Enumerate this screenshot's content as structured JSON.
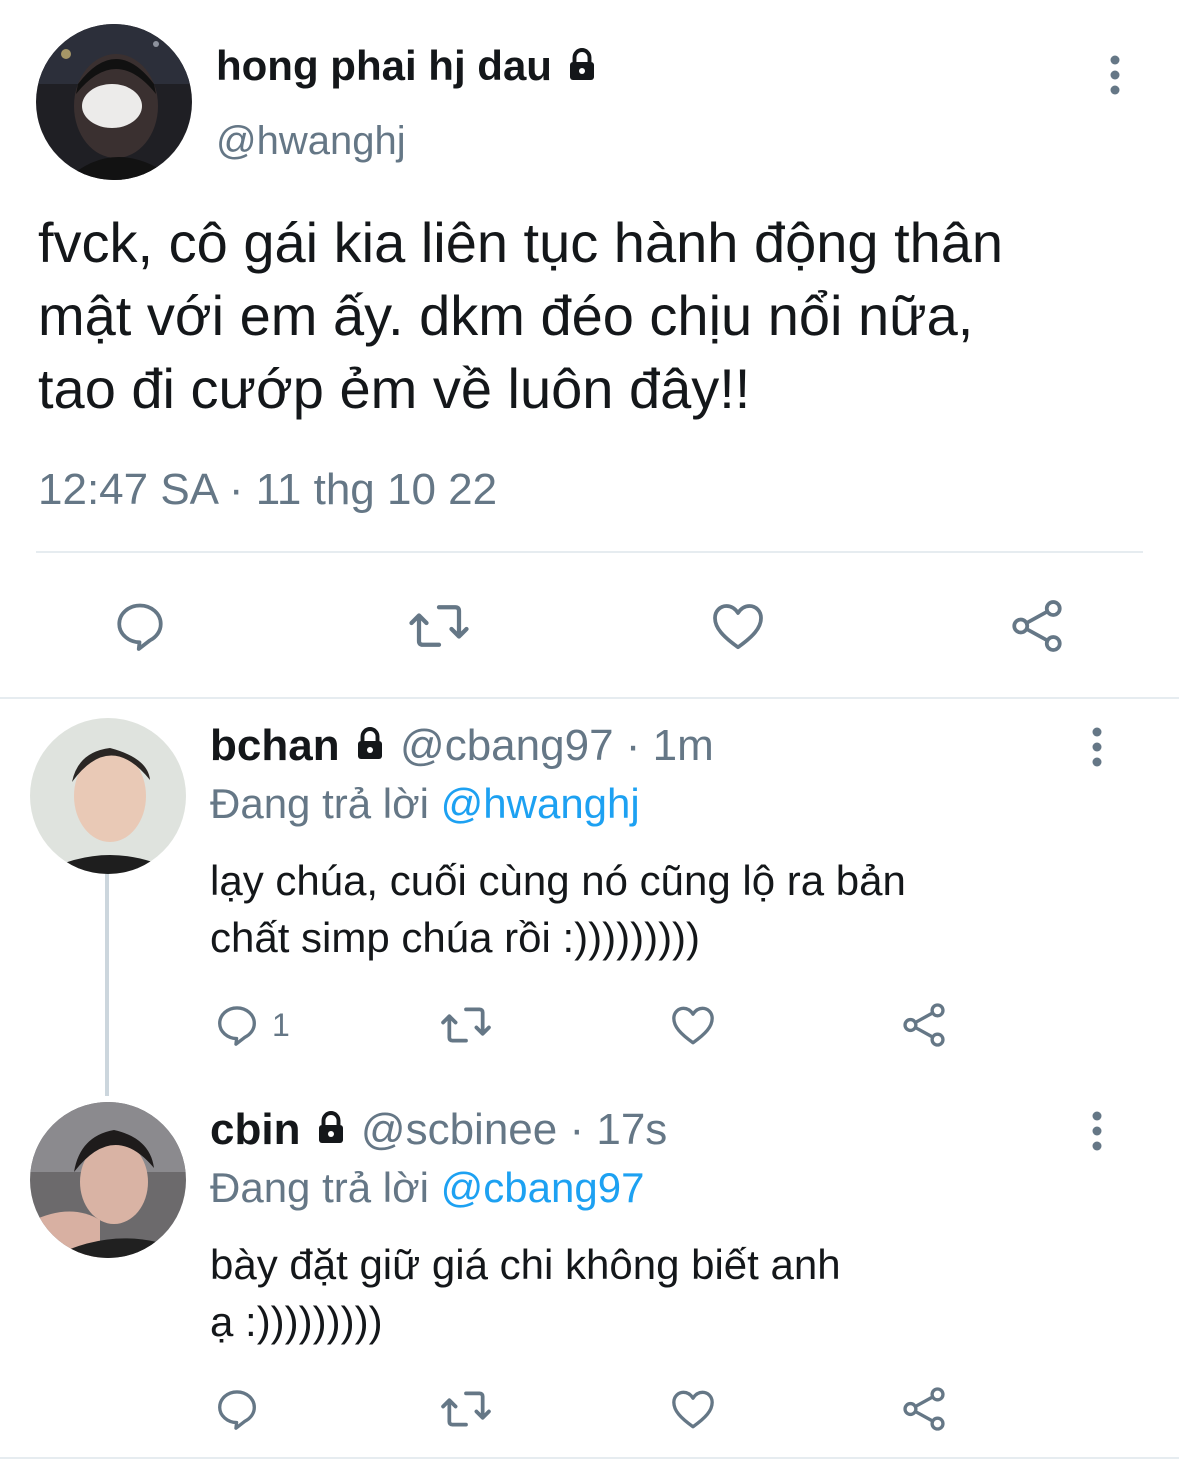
{
  "main_tweet": {
    "display_name": "hong phai hj dau",
    "handle": "@hwanghj",
    "text_lines": [
      "fvck, cô gái kia liên tục hành động thân",
      "mật với em ấy. dkm đéo chịu nổi nữa,",
      "tao đi cướp ẻm về luôn đây!!"
    ],
    "timestamp": "12:47 SA · 11 thg 10 22",
    "icons": {
      "avatar": "avatar-photo",
      "lock": "lock-icon",
      "more": "more-vertical-icon",
      "reply": "reply-icon",
      "retweet": "retweet-icon",
      "like": "heart-icon",
      "share": "share-icon"
    }
  },
  "replies": [
    {
      "display_name": "bchan",
      "handle_time": "@cbang97 · 1m",
      "replying_prefix": "Đang trả lời",
      "replying_to": "@hwanghj",
      "text_lines": [
        "lạy chúa, cuối cùng nó cũng lộ ra bản",
        "chất simp chúa rồi :)))))))))"
      ],
      "reply_count": "1"
    },
    {
      "display_name": "cbin",
      "handle_time": "@scbinee · 17s",
      "replying_prefix": "Đang trả lời",
      "replying_to": "@cbang97",
      "text_lines": [
        "bày đặt giữ giá chi không biết anh",
        "ạ :)))))))))"
      ],
      "reply_count": ""
    }
  ],
  "colors": {
    "text": "#14171a",
    "secondary": "#657786",
    "link": "#1da1f2",
    "divider": "#e6ecf0",
    "thread_line": "#ccd6dd"
  }
}
